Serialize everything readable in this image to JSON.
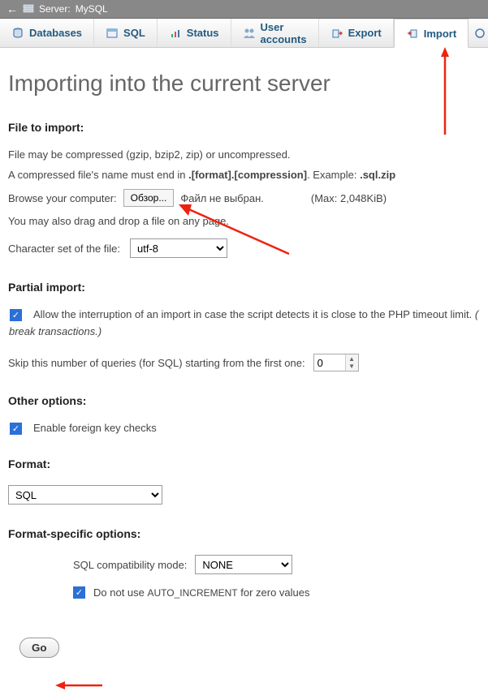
{
  "titlebar": {
    "prefix": "Server:",
    "server": "MySQL"
  },
  "tabs": {
    "databases": "Databases",
    "sql": "SQL",
    "status": "Status",
    "users": "User accounts",
    "export": "Export",
    "import": "Import"
  },
  "page_title": "Importing into the current server",
  "file_section": {
    "heading": "File to import:",
    "compress_note": "File may be compressed (gzip, bzip2, zip) or uncompressed.",
    "name_note_prefix": "A compressed file's name must end in ",
    "name_note_pattern": ".[format].[compression]",
    "name_note_example_label": ". Example: ",
    "name_note_example": ".sql.zip",
    "browse_label": "Browse your computer:",
    "browse_button": "Обзор...",
    "no_file": "Файл не выбран.",
    "max_note": "(Max: 2,048KiB)",
    "drag_note": "You may also drag and drop a file on any page.",
    "charset_label": "Character set of the file:",
    "charset_value": "utf-8"
  },
  "partial": {
    "heading": "Partial import:",
    "allow_text": "Allow the interruption of an import in case the script detects it is close to the PHP timeout limit.",
    "allow_italic": "break transactions.)",
    "skip_label": "Skip this number of queries (for SQL) starting from the first one:",
    "skip_value": "0"
  },
  "other": {
    "heading": "Other options:",
    "fk_label": "Enable foreign key checks"
  },
  "format": {
    "heading": "Format:",
    "value": "SQL"
  },
  "fso": {
    "heading": "Format-specific options:",
    "compat_label": "SQL compatibility mode:",
    "compat_value": "NONE",
    "autoinc_prefix": "Do not use ",
    "autoinc_code": "AUTO_INCREMENT",
    "autoinc_suffix": " for zero values"
  },
  "go_label": "Go"
}
